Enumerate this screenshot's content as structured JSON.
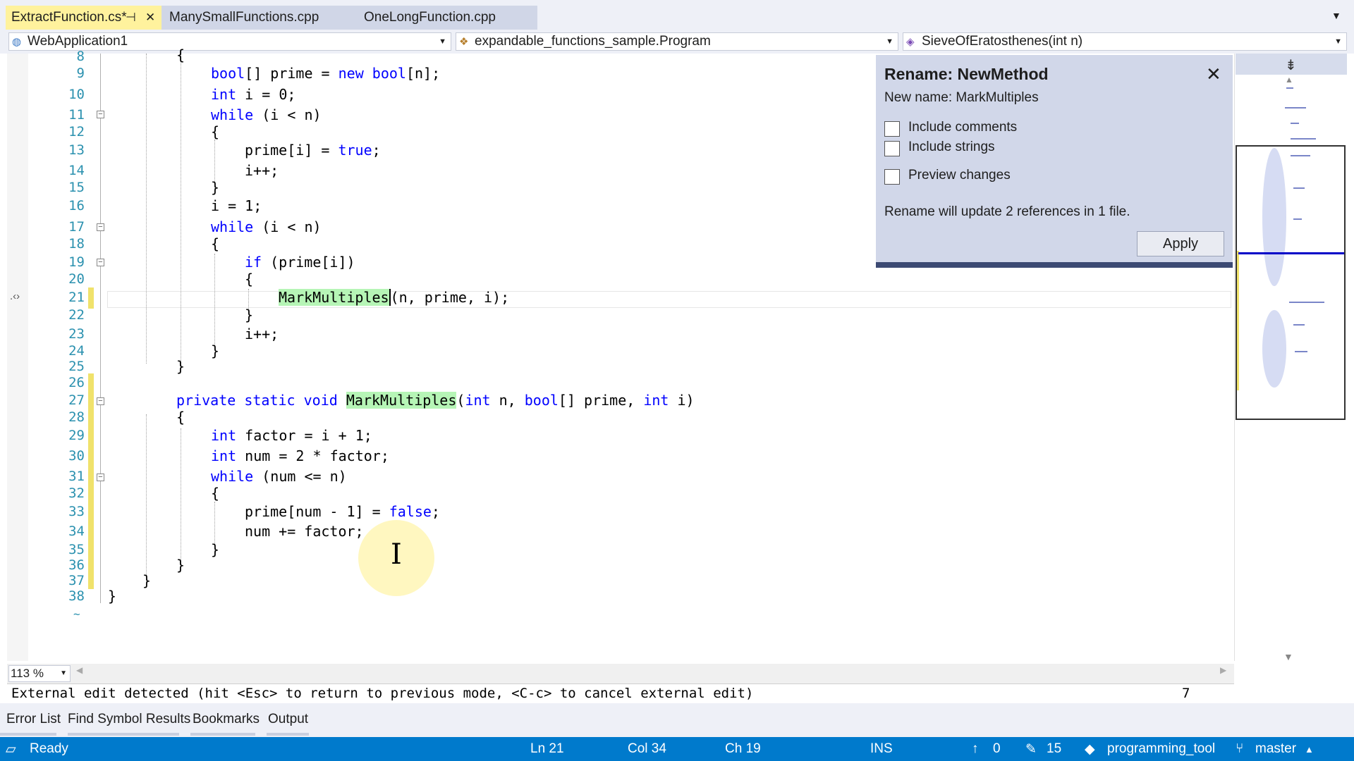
{
  "tabs": [
    {
      "label": "ExtractFunction.cs*",
      "active": true
    },
    {
      "label": "ManySmallFunctions.cpp",
      "active": false
    },
    {
      "label": "OneLongFunction.cpp",
      "active": false
    }
  ],
  "navbar": {
    "project": "WebApplication1",
    "type": "expandable_functions_sample.Program",
    "member": "SieveOfEratosthenes(int n)"
  },
  "code_lines": [
    {
      "n": "8",
      "text": "{"
    },
    {
      "n": "9",
      "text": "bool[] prime = new bool[n];"
    },
    {
      "n": "10",
      "text": "int i = 0;"
    },
    {
      "n": "11",
      "text": "while (i < n)"
    },
    {
      "n": "12",
      "text": "{"
    },
    {
      "n": "13",
      "text": "prime[i] = true;"
    },
    {
      "n": "14",
      "text": "i++;"
    },
    {
      "n": "15",
      "text": "}"
    },
    {
      "n": "16",
      "text": "i = 1;"
    },
    {
      "n": "17",
      "text": "while (i < n)"
    },
    {
      "n": "18",
      "text": "{"
    },
    {
      "n": "19",
      "text": "if (prime[i])"
    },
    {
      "n": "20",
      "text": "{"
    },
    {
      "n": "21",
      "text": "MarkMultiples(n, prime, i);"
    },
    {
      "n": "22",
      "text": "}"
    },
    {
      "n": "23",
      "text": "i++;"
    },
    {
      "n": "24",
      "text": "}"
    },
    {
      "n": "25",
      "text": "}"
    },
    {
      "n": "26",
      "text": ""
    },
    {
      "n": "27",
      "text": "private static void MarkMultiples(int n, bool[] prime, int i)"
    },
    {
      "n": "28",
      "text": "{"
    },
    {
      "n": "29",
      "text": "int factor = i + 1;"
    },
    {
      "n": "30",
      "text": "int num = 2 * factor;"
    },
    {
      "n": "31",
      "text": "while (num <= n)"
    },
    {
      "n": "32",
      "text": "{"
    },
    {
      "n": "33",
      "text": "prime[num - 1] = false;"
    },
    {
      "n": "34",
      "text": "num += factor;"
    },
    {
      "n": "35",
      "text": "}"
    },
    {
      "n": "36",
      "text": "}"
    },
    {
      "n": "37",
      "text": "}"
    },
    {
      "n": "38",
      "text": "}"
    }
  ],
  "rename": {
    "title": "Rename: NewMethod",
    "new_name": "New name: MarkMultiples",
    "opt_comments": "Include comments",
    "opt_strings": "Include strings",
    "opt_preview": "Preview changes",
    "info": "Rename will update 2 references in 1 file.",
    "apply": "Apply"
  },
  "zoom": "113 %",
  "vim": {
    "message": "External edit detected (hit <Esc> to return to previous mode, <C-c> to cancel external edit)",
    "count": "7"
  },
  "tool_tabs": [
    "Error List",
    "Find Symbol Results",
    "Bookmarks",
    "Output"
  ],
  "status": {
    "ready": "Ready",
    "ln": "Ln 21",
    "col": "Col 34",
    "ch": "Ch 19",
    "mode": "INS",
    "push": "0",
    "edits": "15",
    "repo": "programming_tool",
    "branch": "master"
  },
  "colors": {
    "accent": "#007acc",
    "keyword": "#0000ff",
    "linenumber": "#2b91af",
    "change_bar": "#f0e26b",
    "active_tab": "#fff29d"
  }
}
